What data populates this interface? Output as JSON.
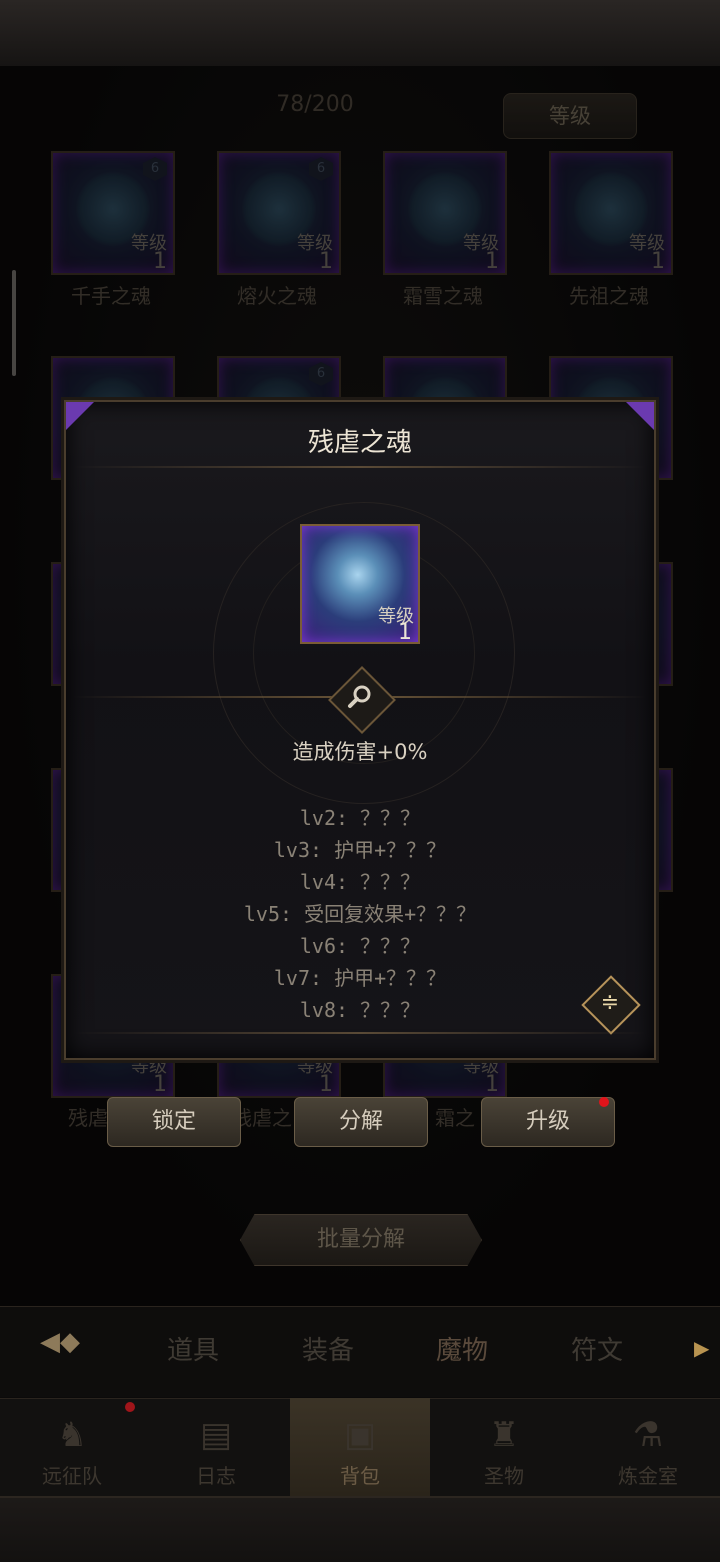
{
  "header": {
    "counter": "78/200",
    "sort_label": "等级"
  },
  "grid": {
    "row1": [
      {
        "name": "千手之魂",
        "badge": "6",
        "level_label": "等级",
        "level": "1"
      },
      {
        "name": "熔火之魂",
        "badge": "6",
        "level_label": "等级",
        "level": "1"
      },
      {
        "name": "霜雪之魂",
        "badge": "",
        "level_label": "等级",
        "level": "1"
      },
      {
        "name": "先祖之魂",
        "badge": "",
        "level_label": "等级",
        "level": "1"
      }
    ],
    "row2_badge": "6",
    "row5": [
      {
        "name": "残虐",
        "level_label": "等级",
        "level": "1"
      },
      {
        "name": "残虐之",
        "level_label": "等级",
        "level": "1"
      },
      {
        "name": "霜之",
        "level_label": "等级",
        "level": "1"
      }
    ]
  },
  "modal": {
    "title": "残虐之魂",
    "card": {
      "level_label": "等级",
      "level": "1"
    },
    "effect": "造成伤害+0%",
    "levels": [
      "lv2: ？？？",
      "lv3: 护甲+？？？",
      "lv4: ？？？",
      "lv5: 受回复效果+？？？",
      "lv6: ？？？",
      "lv7: 护甲+？？？",
      "lv8: ？？？"
    ]
  },
  "actions": {
    "lock": "锁定",
    "decompose": "分解",
    "upgrade": "升级",
    "batch": "批量分解"
  },
  "tabs": [
    "道具",
    "装备",
    "魔物",
    "符文"
  ],
  "nav": [
    "远征队",
    "日志",
    "背包",
    "圣物",
    "炼金室"
  ],
  "colors": {
    "accent_purple": "#6b3ab0",
    "gold": "#b6935a",
    "alert_red": "#e0141b"
  }
}
